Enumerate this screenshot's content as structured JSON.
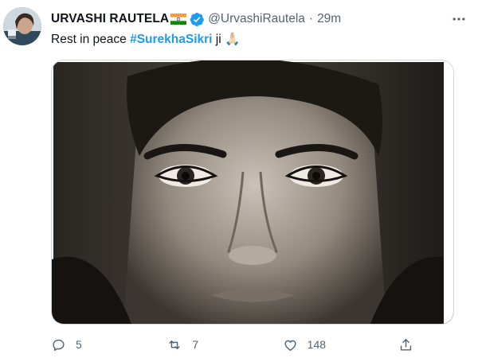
{
  "tweet": {
    "author": {
      "display_name": "URVASHI RAUTELA",
      "handle": "@UrvashiRautela",
      "avatar_icon": "profile-photo",
      "flag_icon": "india-flag-icon",
      "verified_icon": "verified-badge-icon"
    },
    "separator": "·",
    "time": "29m",
    "text": {
      "prefix": "Rest in peace ",
      "hashtag": "#SurekhaSikri",
      "suffix": " ji ",
      "emoji": "🙏🏻"
    },
    "media": {
      "description_icon": "tweet-photo"
    },
    "actions": {
      "reply": {
        "icon": "reply-icon",
        "count": "5"
      },
      "retweet": {
        "icon": "retweet-icon",
        "count": "7"
      },
      "like": {
        "icon": "like-icon",
        "count": "148"
      },
      "share": {
        "icon": "share-icon"
      }
    },
    "colors": {
      "accent": "#1d9bf0",
      "text": "#0f1419",
      "muted": "#536471",
      "border": "#cfd9de"
    }
  }
}
